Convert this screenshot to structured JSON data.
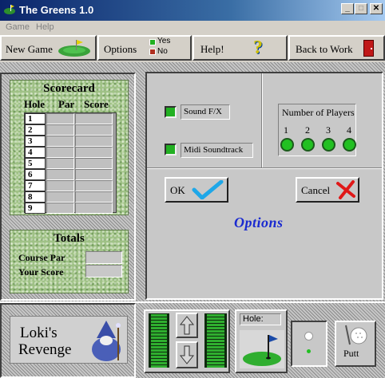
{
  "window": {
    "title": "The Greens 1.0"
  },
  "menu": [
    "Game",
    "Help"
  ],
  "toolbar": {
    "new_game": "New Game",
    "options": "Options",
    "legend_yes": "Yes",
    "legend_no": "No",
    "help": "Help!",
    "back_to_work": "Back to Work"
  },
  "scorecard": {
    "title": "Scorecard",
    "headers": [
      "Hole",
      "Par",
      "Score"
    ],
    "holes": [
      "1",
      "2",
      "3",
      "4",
      "5",
      "6",
      "7",
      "8",
      "9"
    ]
  },
  "totals": {
    "title": "Totals",
    "course_par_label": "Course Par",
    "your_score_label": "Your Score"
  },
  "options_panel": {
    "sound_fx": "Sound F/X",
    "midi": "Midi Soundtrack",
    "players_label": "Number of Players",
    "players": [
      "1",
      "2",
      "3",
      "4"
    ],
    "ok": "OK",
    "cancel": "Cancel",
    "heading": "Options"
  },
  "bottom": {
    "logo_line1": "Loki's",
    "logo_line2": "Revenge",
    "hole_label": "Hole:",
    "putt": "Putt"
  },
  "colors": {
    "accent_green": "#22b022",
    "title_blue": "#0a246a",
    "options_blue": "#1a2ad0"
  }
}
